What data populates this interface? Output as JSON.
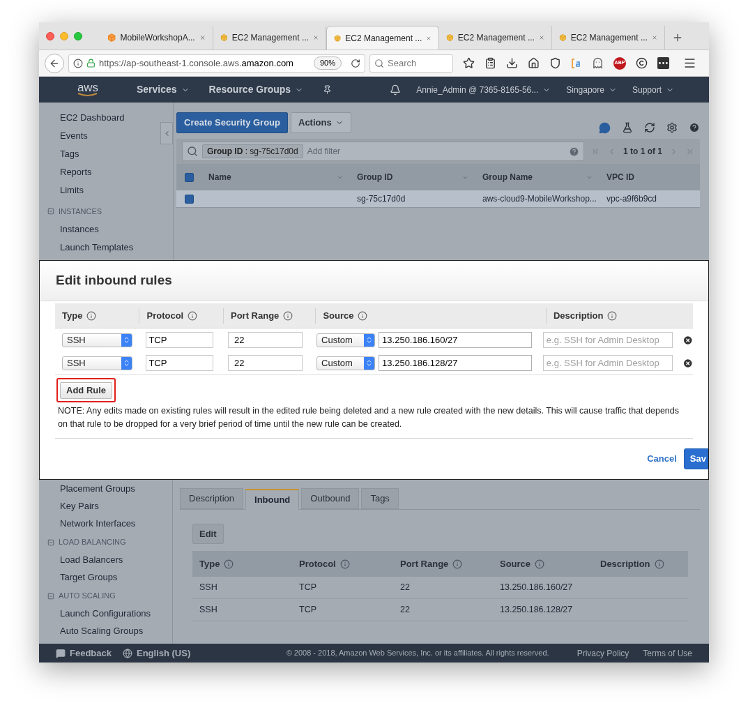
{
  "browser": {
    "tabs": [
      {
        "label": "MobileWorkshopA...",
        "selected": false
      },
      {
        "label": "EC2 Management ...",
        "selected": false
      },
      {
        "label": "EC2 Management ...",
        "selected": true
      },
      {
        "label": "EC2 Management ...",
        "selected": false
      },
      {
        "label": "EC2 Management ...",
        "selected": false
      }
    ],
    "url_prefix": "https://ap-southeast-1.console.aws.",
    "url_domain": "amazon.com",
    "zoom": "90%",
    "search_placeholder": "Search",
    "adblock": "ABP"
  },
  "nav": {
    "logo": "aws",
    "menus": [
      "Services",
      "Resource Groups"
    ],
    "user": "Annie_Admin @ 7365-8165-56...",
    "region": "Singapore",
    "support": "Support"
  },
  "sidebar_top": [
    {
      "kind": "link",
      "label": "EC2 Dashboard"
    },
    {
      "kind": "link",
      "label": "Events"
    },
    {
      "kind": "link",
      "label": "Tags"
    },
    {
      "kind": "link",
      "label": "Reports"
    },
    {
      "kind": "link",
      "label": "Limits"
    },
    {
      "kind": "section",
      "label": "INSTANCES"
    },
    {
      "kind": "link",
      "label": "Instances"
    },
    {
      "kind": "link",
      "label": "Launch Templates"
    }
  ],
  "sidebar_bottom": [
    {
      "kind": "link",
      "label": "Placement Groups"
    },
    {
      "kind": "link",
      "label": "Key Pairs"
    },
    {
      "kind": "link",
      "label": "Network Interfaces"
    },
    {
      "kind": "section",
      "label": "LOAD BALANCING"
    },
    {
      "kind": "link",
      "label": "Load Balancers"
    },
    {
      "kind": "link",
      "label": "Target Groups"
    },
    {
      "kind": "section",
      "label": "AUTO SCALING"
    },
    {
      "kind": "link",
      "label": "Launch Configurations"
    },
    {
      "kind": "link",
      "label": "Auto Scaling Groups"
    }
  ],
  "toolbar": {
    "create_button": "Create Security Group",
    "actions_button": "Actions"
  },
  "filter": {
    "tag": "**Group ID** : sg-75c17d0d",
    "placeholder": "Add filter",
    "pagination": "1 to 1 of 1"
  },
  "groups_table": {
    "header_checked": true,
    "columns": [
      "Name",
      "Group ID",
      "Group Name",
      "VPC ID"
    ],
    "rows": [
      {
        "checked": true,
        "selected": true,
        "group_id": "sg-75c17d0d",
        "group_name": "aws-cloud9-MobileWorkshop...",
        "vpc_id": "vpc-a9f6b9cd"
      }
    ]
  },
  "dialog": {
    "title": "Edit inbound rules",
    "columns": [
      "Type",
      "Protocol",
      "Port Range",
      "Source",
      "Description"
    ],
    "rules": [
      {
        "type": "SSH",
        "protocol": "TCP",
        "port_range": "22",
        "source_kind": "Custom",
        "source": "13.250.186.160/27",
        "description_placeholder": "e.g. SSH for Admin Desktop"
      },
      {
        "type": "SSH",
        "protocol": "TCP",
        "port_range": "22",
        "source_kind": "Custom",
        "source": "13.250.186.128/27",
        "description_placeholder": "e.g. SSH for Admin Desktop"
      }
    ],
    "add_rule": {
      "label": "Add Rule",
      "highlighted": true
    },
    "note": "NOTE: Any edits made on existing rules will result in the edited rule being deleted and a new rule created with the new details. This will cause traffic that depends on that rule to be dropped for a very brief period of time until the new rule can be created.",
    "cancel": "Cancel",
    "save": "Sav"
  },
  "details": {
    "tabs": [
      {
        "label": "Description",
        "selected": false
      },
      {
        "label": "Inbound",
        "selected": true
      },
      {
        "label": "Outbound",
        "selected": false
      },
      {
        "label": "Tags",
        "selected": false
      }
    ],
    "edit_button": "Edit",
    "columns": [
      "Type",
      "Protocol",
      "Port Range",
      "Source",
      "Description"
    ],
    "rows": [
      {
        "type": "SSH",
        "protocol": "TCP",
        "port_range": "22",
        "source": "13.250.186.160/27"
      },
      {
        "type": "SSH",
        "protocol": "TCP",
        "port_range": "22",
        "source": "13.250.186.128/27"
      }
    ]
  },
  "footer": {
    "feedback": "Feedback",
    "language": "English (US)",
    "copyright": "© 2008 - 2018, Amazon Web Services, Inc. or its affiliates. All rights reserved.",
    "links": [
      "Privacy Policy",
      "Terms of Use"
    ]
  }
}
